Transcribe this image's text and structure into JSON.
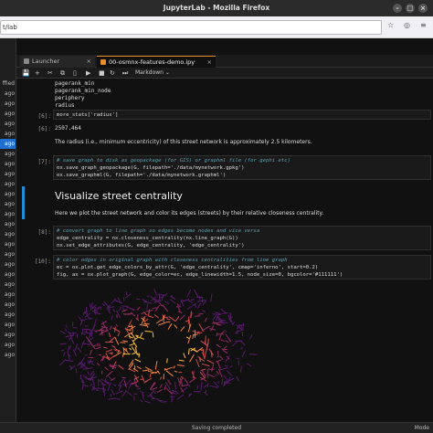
{
  "window": {
    "title": "JupyterLab - Mozilla Firefox"
  },
  "urlbar": {
    "url": "t/lab"
  },
  "file_browser": {
    "items": [
      {
        "label": "ffied",
        "selected": false
      },
      {
        "label": "ago",
        "selected": false
      },
      {
        "label": "ago",
        "selected": false
      },
      {
        "label": "ago",
        "selected": false
      },
      {
        "label": "ago",
        "selected": false
      },
      {
        "label": "ago",
        "selected": false
      },
      {
        "label": "ago",
        "selected": true
      },
      {
        "label": "ago",
        "selected": false
      },
      {
        "label": "ago",
        "selected": false
      },
      {
        "label": "ago",
        "selected": false
      },
      {
        "label": "ago",
        "selected": false
      },
      {
        "label": "ago",
        "selected": false
      },
      {
        "label": "ago",
        "selected": false
      },
      {
        "label": "ago",
        "selected": false
      },
      {
        "label": "ago",
        "selected": false
      },
      {
        "label": "ago",
        "selected": false
      },
      {
        "label": "ago",
        "selected": false
      },
      {
        "label": "ago",
        "selected": false
      },
      {
        "label": "ago",
        "selected": false
      },
      {
        "label": "ago",
        "selected": false
      },
      {
        "label": "ago",
        "selected": false
      },
      {
        "label": "ago",
        "selected": false
      },
      {
        "label": "ago",
        "selected": false
      },
      {
        "label": "ago",
        "selected": false
      },
      {
        "label": "ago",
        "selected": false
      },
      {
        "label": "ago",
        "selected": false
      },
      {
        "label": "ago",
        "selected": false
      },
      {
        "label": "ago",
        "selected": false
      }
    ]
  },
  "tabs": [
    {
      "label": "Launcher"
    },
    {
      "label": "00-osmnx-features-demo.ipy"
    }
  ],
  "toolbar": {
    "celltype": "Markdown"
  },
  "notebook": {
    "output_list": "pagerank_min\npagerank_min_node\nperiphery\nradius",
    "cell6_prompt": "[6]:",
    "cell6_code": "more_stats['radius']",
    "out6_prompt": "[6]:",
    "out6_value": "2507.464",
    "md_radius": "The radius (i.e., minimum eccentricity) of this street network is approximately 2.5 kilometers.",
    "cell7_prompt": "[7]:",
    "cell7_line1": "# save graph to disk as geopackage (for GIS) or graphml file (for gephi etc)",
    "cell7_line2": "ox.save_graph_geopackage(G, filepath='./data/mynetwork.gpkg')",
    "cell7_line3": "ox.save_graphml(G, filepath='./data/mynetwork.graphml')",
    "heading": "Visualize street centrality",
    "md_centrality": "Here we plot the street network and color its edges (streets) by their relative closeness centrality.",
    "cell8_prompt": "[8]:",
    "cell8_line1": "# convert graph to line graph so edges become nodes and vice versa",
    "cell8_line2": "edge_centrality = nx.closeness_centrality(nx.line_graph(G))",
    "cell8_line3": "nx.set_edge_attributes(G, edge_centrality, 'edge_centrality')",
    "cell10_prompt": "[10]:",
    "cell10_line1": "# color edges in original graph with closeness centralities from line graph",
    "cell10_line2": "ec = ox.plot.get_edge_colors_by_attr(G, 'edge_centrality', cmap='inferno', start=0.2)",
    "cell10_line3": "fig, ax = ox.plot_graph(G, edge_color=ec, edge_linewidth=1.5, node_size=0, bgcolor='#111111')"
  },
  "plot": {
    "bgcolor": "#111111",
    "cmap": "inferno",
    "colors": [
      "#5a1a6e",
      "#9b2964",
      "#d5484a",
      "#f6813a",
      "#fbbf3a",
      "#fcf6a0"
    ]
  },
  "status": {
    "center": "Saving completed",
    "right": "Mode"
  },
  "colors": {
    "accent": "#1f6fd1",
    "tab_accent": "#e78f2a",
    "active_cell": "#1f8ed9"
  }
}
